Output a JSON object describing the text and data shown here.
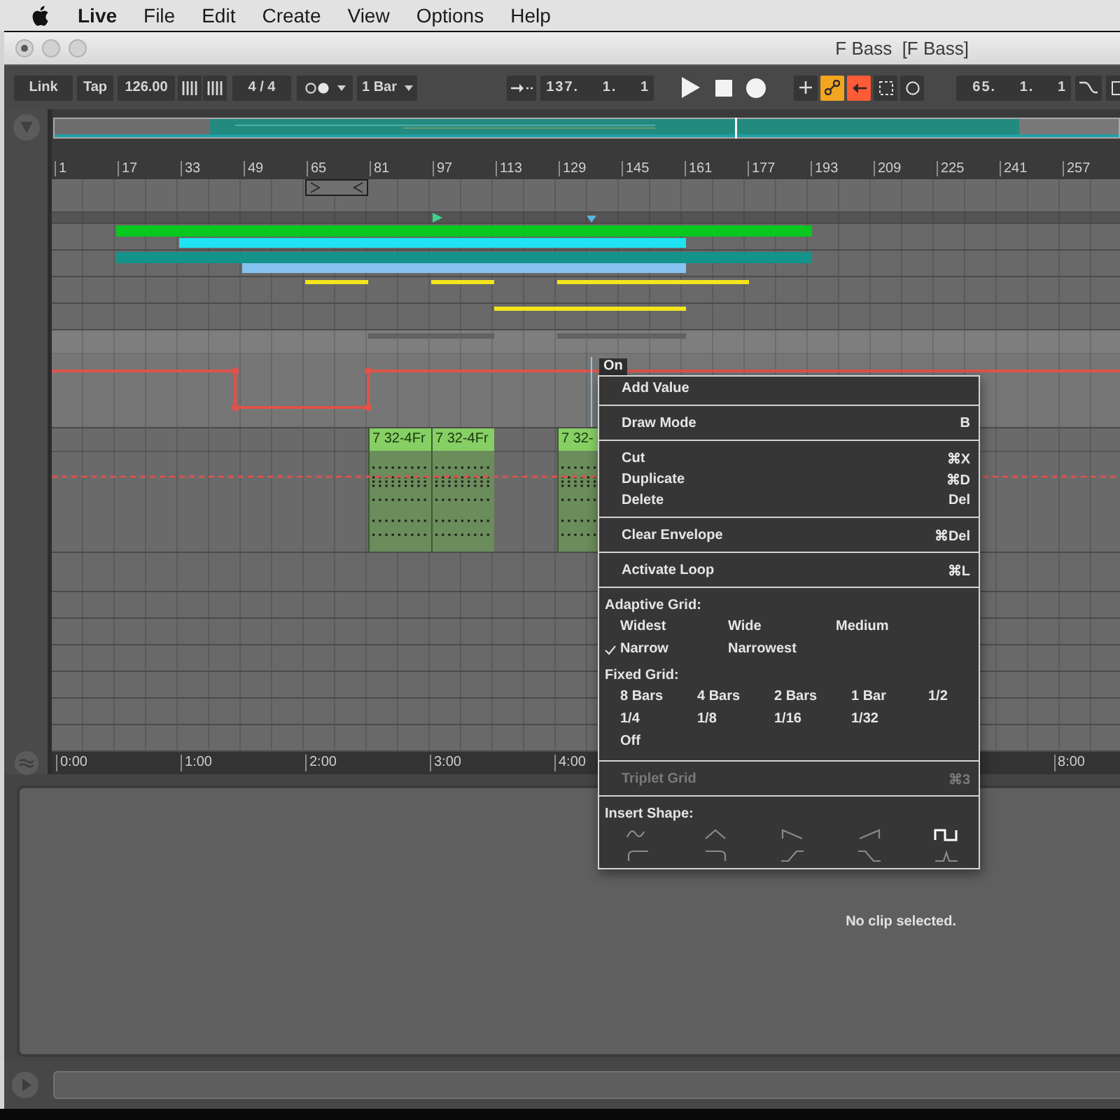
{
  "menu_bar": {
    "app_name": "Live",
    "menus": [
      "File",
      "Edit",
      "Create",
      "View",
      "Options",
      "Help"
    ]
  },
  "window": {
    "title": "F Bass  [F Bass]",
    "unsaved": true
  },
  "control_bar": {
    "link": "Link",
    "tap": "Tap",
    "tempo": "126.00",
    "time_signature": "4 / 4",
    "quantization": "1 Bar",
    "position": "137. 1. 1",
    "loop_start": "65. 1. 1",
    "toggles": [
      {
        "kind": "add",
        "on": false
      },
      {
        "kind": "automation-arm",
        "on": true
      },
      {
        "kind": "re-enable-automation",
        "on": true
      },
      {
        "kind": "capture",
        "on": false
      },
      {
        "kind": "session-record",
        "on": false
      }
    ]
  },
  "arrangement": {
    "bar_ruler": [
      "1",
      "17",
      "33",
      "49",
      "65",
      "81",
      "97",
      "113",
      "129",
      "145",
      "161",
      "177",
      "193",
      "209",
      "225",
      "241",
      "257"
    ],
    "tracks": [
      {
        "clips": [
          {
            "color": "#08c71f"
          },
          {
            "color": "#1fe3f2"
          }
        ]
      },
      {
        "clips": [
          {
            "color": "#14938b"
          },
          {
            "color": "#86c3f0"
          }
        ]
      },
      {
        "clips": [
          {
            "color": "#f2e51d"
          },
          {
            "color": "#f2e51d"
          },
          {
            "color": "#f2e51d"
          }
        ]
      },
      {
        "clips": [
          {
            "color": "#f2e51d"
          }
        ]
      }
    ],
    "midi_clips": [
      {
        "name": "7 32-4Fr"
      },
      {
        "name": "7 32-4Fr"
      },
      {
        "name": "7 32-"
      }
    ],
    "time_ruler": [
      "0:00",
      "1:00",
      "2:00",
      "3:00",
      "4:00",
      "8:00"
    ]
  },
  "context_menu": {
    "tooltip": "On",
    "sections": [
      {
        "kind": "commands",
        "items": [
          {
            "label": "Add Value",
            "disabled": false
          }
        ]
      },
      {
        "kind": "commands",
        "items": [
          {
            "label": "Draw Mode",
            "shortcut": "B",
            "disabled": false
          }
        ]
      },
      {
        "kind": "commands",
        "items": [
          {
            "label": "Cut",
            "shortcut": "⌘X",
            "disabled": false
          },
          {
            "label": "Duplicate",
            "shortcut": "⌘D",
            "disabled": false
          },
          {
            "label": "Delete",
            "shortcut": "Del",
            "disabled": false
          }
        ]
      },
      {
        "kind": "commands",
        "items": [
          {
            "label": "Clear Envelope",
            "shortcut": "⌘Del",
            "disabled": false
          }
        ]
      },
      {
        "kind": "commands",
        "items": [
          {
            "label": "Activate Loop",
            "shortcut": "⌘L",
            "disabled": false
          }
        ]
      },
      {
        "kind": "grids",
        "groups": [
          {
            "kind": "adaptive",
            "heading": "Adaptive Grid:",
            "rows": [
              [
                {
                  "label": "Widest",
                  "selected": false
                },
                {
                  "label": "Wide",
                  "selected": false
                },
                {
                  "label": "Medium",
                  "selected": false
                }
              ],
              [
                {
                  "label": "Narrow",
                  "selected": true
                },
                {
                  "label": "Narrowest",
                  "selected": false
                }
              ]
            ]
          },
          {
            "kind": "fixed",
            "heading": "Fixed Grid:",
            "rows": [
              [
                {
                  "label": "8 Bars",
                  "selected": false
                },
                {
                  "label": "4 Bars",
                  "selected": false
                },
                {
                  "label": "2 Bars",
                  "selected": false
                },
                {
                  "label": "1 Bar",
                  "selected": false
                },
                {
                  "label": "1/2",
                  "selected": false
                }
              ],
              [
                {
                  "label": "1/4",
                  "selected": false
                },
                {
                  "label": "1/8",
                  "selected": false
                },
                {
                  "label": "1/16",
                  "selected": false
                },
                {
                  "label": "1/32",
                  "selected": false
                }
              ],
              [
                {
                  "label": "Off",
                  "selected": false
                }
              ]
            ]
          }
        ]
      },
      {
        "kind": "commands",
        "items": [
          {
            "label": "Triplet Grid",
            "shortcut": "⌘3",
            "disabled": true
          }
        ]
      },
      {
        "kind": "shapes",
        "heading": "Insert Shape:",
        "rows": [
          [
            {
              "kind": "sine",
              "selected": false
            },
            {
              "kind": "triangle",
              "selected": false
            },
            {
              "kind": "ramp-down",
              "selected": false
            },
            {
              "kind": "ramp-up",
              "selected": false
            },
            {
              "kind": "square",
              "selected": true
            }
          ],
          [
            {
              "kind": "ease-in",
              "selected": false
            },
            {
              "kind": "ease-out",
              "selected": false
            },
            {
              "kind": "rise",
              "selected": false
            },
            {
              "kind": "fall",
              "selected": false
            },
            {
              "kind": "spike",
              "selected": false
            }
          ]
        ]
      }
    ]
  },
  "detail": {
    "message": "No clip selected."
  }
}
